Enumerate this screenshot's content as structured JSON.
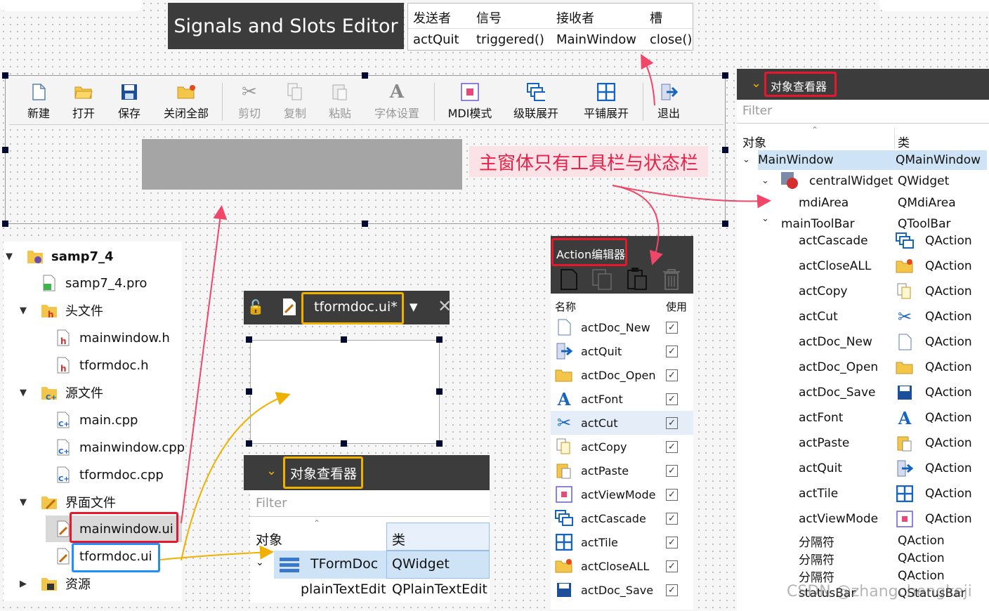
{
  "signals_editor": {
    "title": "Signals and Slots Editor",
    "headers": [
      "发送者",
      "信号",
      "接收者",
      "槽"
    ],
    "row": [
      "actQuit",
      "triggered()",
      "MainWindow",
      "close()"
    ]
  },
  "toolbar": {
    "buttons": [
      {
        "label": "新建",
        "icon": "new-file-icon",
        "enabled": true
      },
      {
        "label": "打开",
        "icon": "open-folder-icon",
        "enabled": true
      },
      {
        "label": "保存",
        "icon": "save-disk-icon",
        "enabled": true
      },
      {
        "label": "关闭全部",
        "icon": "close-all-icon",
        "enabled": true
      },
      {
        "label": "剪切",
        "icon": "scissors-icon",
        "enabled": false
      },
      {
        "label": "复制",
        "icon": "copy-icon",
        "enabled": false
      },
      {
        "label": "粘贴",
        "icon": "paste-icon",
        "enabled": false
      },
      {
        "label": "字体设置",
        "icon": "font-icon",
        "enabled": false
      },
      {
        "label": "MDI模式",
        "icon": "mdi-mode-icon",
        "enabled": true
      },
      {
        "label": "级联展开",
        "icon": "cascade-icon",
        "enabled": true
      },
      {
        "label": "平铺展开",
        "icon": "tile-icon",
        "enabled": true
      },
      {
        "label": "退出",
        "icon": "exit-icon",
        "enabled": true
      }
    ]
  },
  "annotation": "主窗体只有工具栏与状态栏",
  "project_tree": {
    "items": [
      {
        "label": "samp7_4",
        "bold": true,
        "icon": "project-icon"
      },
      {
        "label": "samp7_4.pro",
        "icon": "pro-file-icon"
      },
      {
        "label": "头文件",
        "icon": "header-folder-icon"
      },
      {
        "label": "mainwindow.h",
        "icon": "header-file-icon"
      },
      {
        "label": "tformdoc.h",
        "icon": "header-file-icon"
      },
      {
        "label": "源文件",
        "icon": "source-folder-icon"
      },
      {
        "label": "main.cpp",
        "icon": "cpp-file-icon"
      },
      {
        "label": "mainwindow.cpp",
        "icon": "cpp-file-icon"
      },
      {
        "label": "tformdoc.cpp",
        "icon": "cpp-file-icon"
      },
      {
        "label": "界面文件",
        "icon": "forms-folder-icon"
      },
      {
        "label": "mainwindow.ui",
        "icon": "ui-file-icon"
      },
      {
        "label": "tformdoc.ui",
        "icon": "ui-file-icon"
      },
      {
        "label": "资源",
        "icon": "resources-folder-icon"
      }
    ]
  },
  "tformdoc_editor": {
    "tab_label": "tformdoc.ui*"
  },
  "tformdoc_inspector": {
    "title": "对象查看器",
    "filter_placeholder": "Filter",
    "col_object": "对象",
    "col_class": "类",
    "rows": [
      {
        "object": "TFormDoc",
        "class": "QWidget"
      },
      {
        "object": "plainTextEdit",
        "class": "QPlainTextEdit"
      }
    ]
  },
  "action_editor": {
    "title": "Action编辑器",
    "col_name": "名称",
    "col_used": "使用",
    "actions": [
      "actDoc_New",
      "actQuit",
      "actDoc_Open",
      "actFont",
      "actCut",
      "actCopy",
      "actPaste",
      "actViewMode",
      "actCascade",
      "actTile",
      "actCloseALL",
      "actDoc_Save"
    ]
  },
  "object_inspector": {
    "title": "对象查看器",
    "filter_placeholder": "Filter",
    "col_object": "对象",
    "col_class": "类",
    "rows": [
      {
        "object": "MainWindow",
        "class": "QMainWindow"
      },
      {
        "object": "centralWidget",
        "class": "QWidget"
      },
      {
        "object": "mdiArea",
        "class": "QMdiArea"
      },
      {
        "object": "mainToolBar",
        "class": "QToolBar"
      },
      {
        "object": "actCascade",
        "class": "QAction"
      },
      {
        "object": "actCloseALL",
        "class": "QAction"
      },
      {
        "object": "actCopy",
        "class": "QAction"
      },
      {
        "object": "actCut",
        "class": "QAction"
      },
      {
        "object": "actDoc_New",
        "class": "QAction"
      },
      {
        "object": "actDoc_Open",
        "class": "QAction"
      },
      {
        "object": "actDoc_Save",
        "class": "QAction"
      },
      {
        "object": "actFont",
        "class": "QAction"
      },
      {
        "object": "actPaste",
        "class": "QAction"
      },
      {
        "object": "actQuit",
        "class": "QAction"
      },
      {
        "object": "actTile",
        "class": "QAction"
      },
      {
        "object": "actViewMode",
        "class": "QAction"
      },
      {
        "object": "分隔符",
        "class": "QAction"
      },
      {
        "object": "分隔符",
        "class": "QAction"
      },
      {
        "object": "分隔符",
        "class": "QAction"
      },
      {
        "object": "statusBar",
        "class": "QStatusBar"
      }
    ]
  },
  "watermark": "CSDN @zhangchengkeji",
  "colors": {
    "annotation_red": "#e8182c",
    "highlight_yellow": "#f0b000",
    "highlight_blue": "#1e90ff",
    "panel_dark": "#3c3c3c",
    "selection": "#cfe3f6"
  }
}
